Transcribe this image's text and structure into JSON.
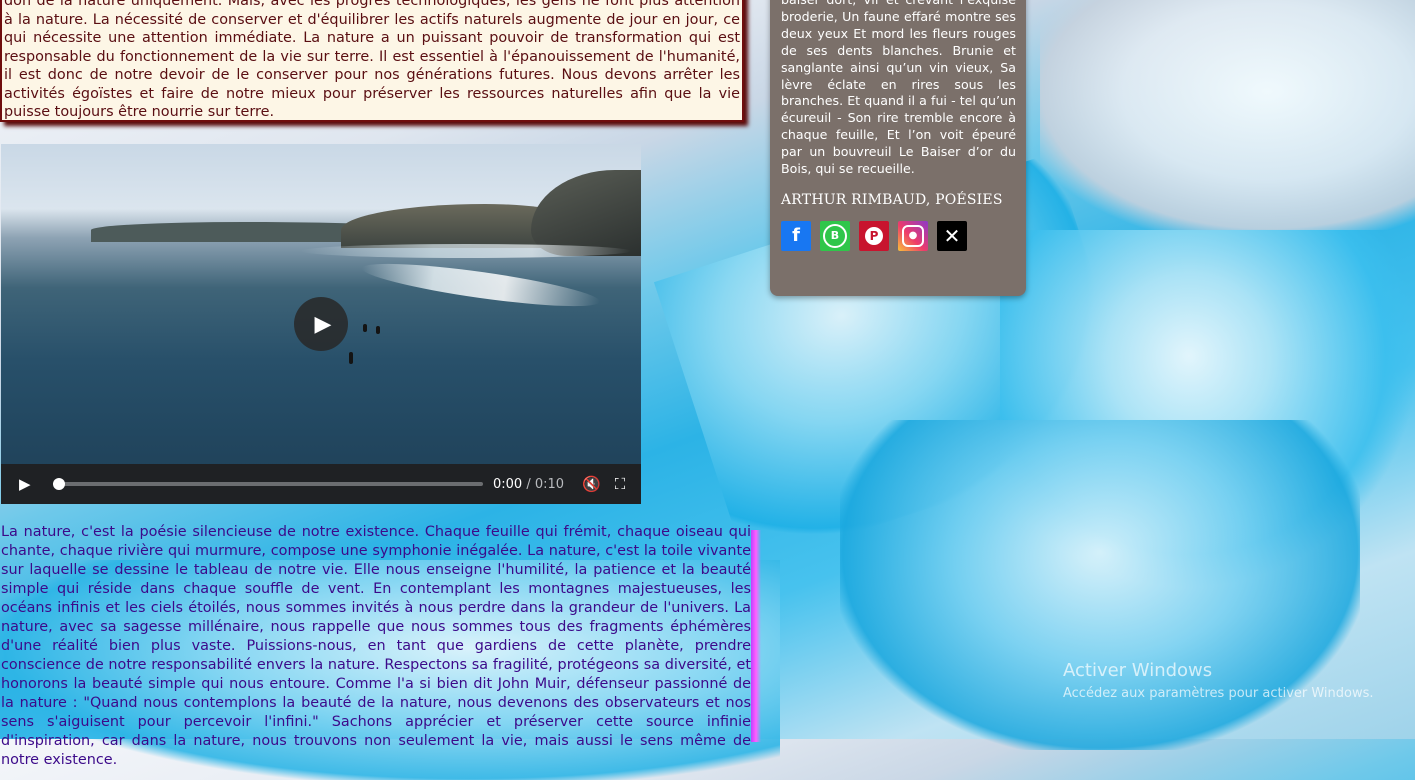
{
  "top_paragraph": "don de la nature uniquement. Mais, avec les progrès technologiques, les gens ne font plus attention à la nature. La nécessité de conserver et d'équilibrer les actifs naturels augmente de jour en jour, ce qui nécessite une attention immédiate. La nature a un puissant pouvoir de transformation qui est responsable du fonctionnement de la vie sur terre. Il est essentiel à l'épanouissement de l'humanité, il est donc de notre devoir de le conserver pour nos générations futures. Nous devons arrêter les activités égoïstes et faire de notre mieux pour préserver les ressources naturelles afin que la vie puisse toujours être nourrie sur terre.",
  "video": {
    "current_time": "0:00",
    "separator": "/",
    "duration": "0:10",
    "progress": 0
  },
  "bottom_paragraph": "La nature, c'est la poésie silencieuse de notre existence. Chaque feuille qui frémit, chaque oiseau qui chante, chaque rivière qui murmure, compose une symphonie inégalée. La nature, c'est la toile vivante sur laquelle se dessine le tableau de notre vie. Elle nous enseigne l'humilité, la patience et la beauté simple qui réside dans chaque souffle de vent. En contemplant les montagnes majestueuses, les océans infinis et les ciels étoilés, nous sommes invités à nous perdre dans la grandeur de l'univers. La nature, avec sa sagesse millénaire, nous rappelle que nous sommes tous des fragments éphémères d'une réalité bien plus vaste. Puissions-nous, en tant que gardiens de cette planète, prendre conscience de notre responsabilité envers la nature. Respectons sa fragilité, protégeons sa diversité, et honorons la beauté simple qui nous entoure. Comme l'a si bien dit John Muir, défenseur passionné de la nature : \"Quand nous contemplons la beauté de la nature, nous devenons des observateurs et nos sens s'aiguisent pour percevoir l'infini.\" Sachons apprécier et préserver cette source infinie d'inspiration, car dans la nature, nous trouvons non seulement la vie, mais aussi le sens même de notre existence.",
  "poem": {
    "text": "baiser dort, Vif et crevant l’exquise broderie, Un faune effaré montre ses deux yeux Et mord les fleurs rouges de ses dents blanches. Brunie et sanglante ainsi qu’un vin vieux, Sa lèvre éclate en rires sous les branches. Et quand il a fui - tel qu’un écureuil - Son rire tremble encore à chaque feuille, Et l’on voit épeuré par un bouvreuil Le Baiser d’or du Bois, qui se recueille.",
    "author": "ARTHUR RIMBAUD, POÉSIES"
  },
  "socials": [
    {
      "name": "facebook",
      "glyph": "f"
    },
    {
      "name": "whatsapp",
      "glyph": "B"
    },
    {
      "name": "pinterest",
      "glyph": "P"
    },
    {
      "name": "instagram",
      "glyph": "●"
    },
    {
      "name": "x",
      "glyph": "✕"
    }
  ],
  "windows_watermark": {
    "title": "Activer Windows",
    "subtitle": "Accédez aux paramètres pour activer Windows."
  },
  "colors": {
    "top_text": "#5a0e12",
    "bottom_text": "#3c0a8a",
    "poem_card_bg": "#7b706a"
  }
}
